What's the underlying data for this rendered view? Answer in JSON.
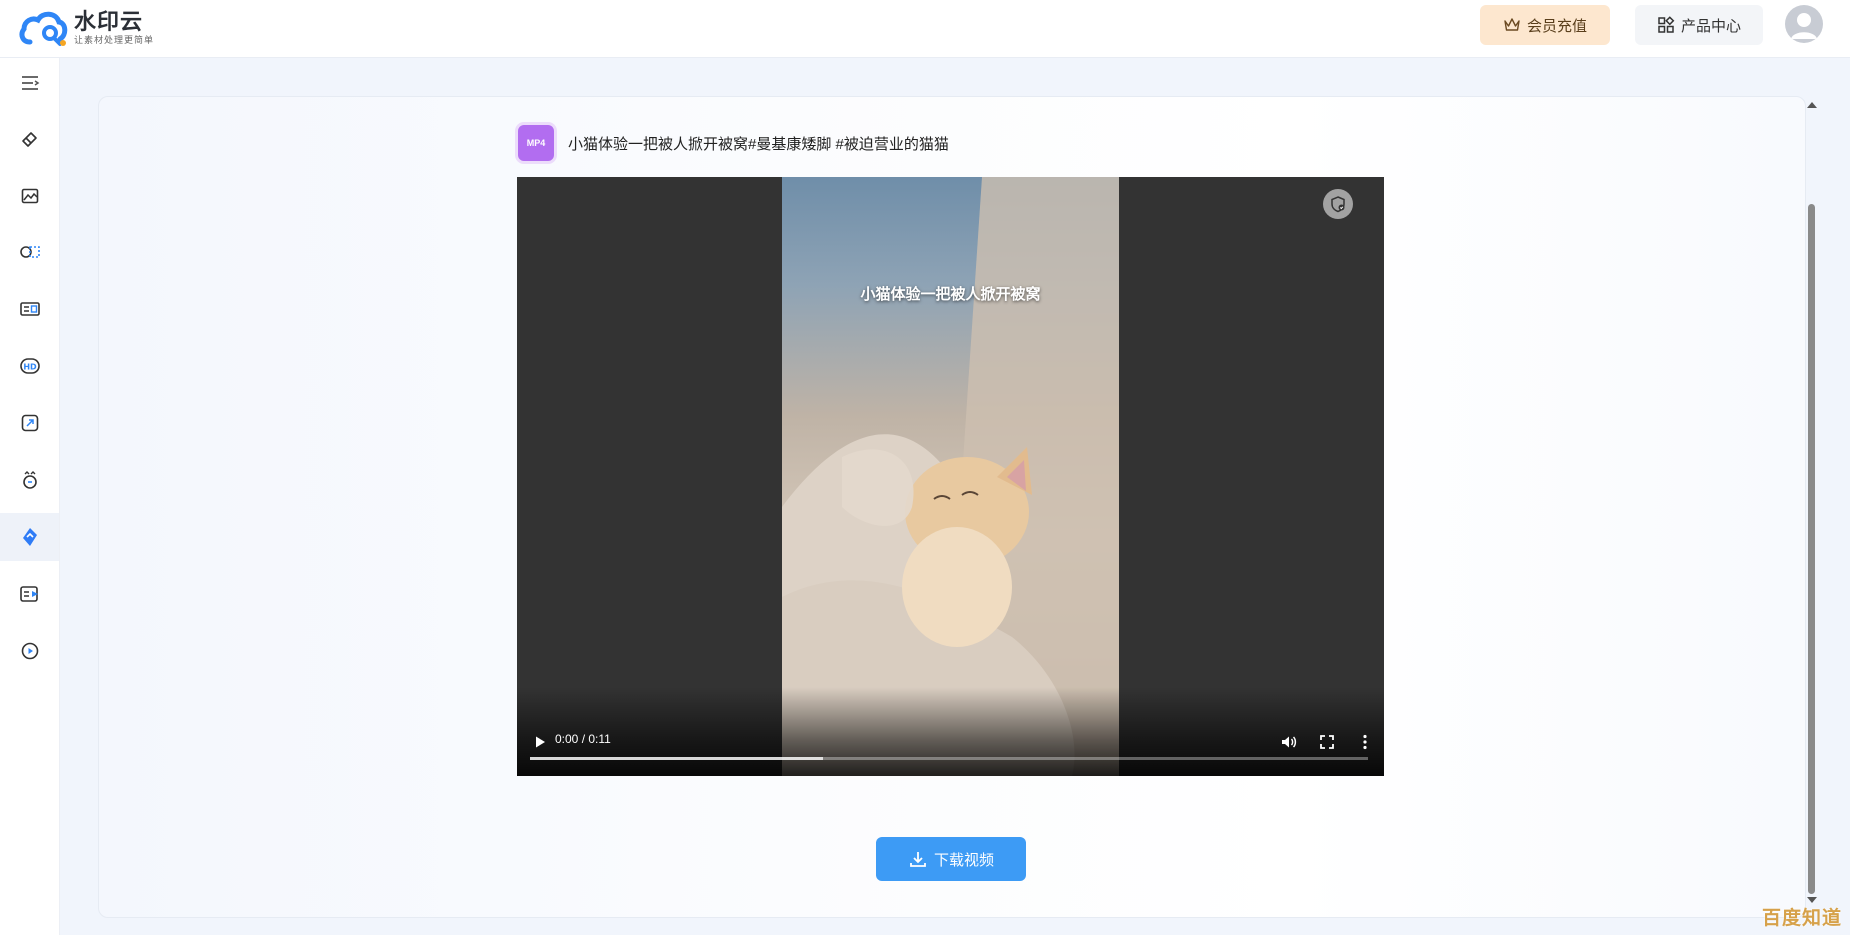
{
  "app": {
    "name": "水印云",
    "slogan": "让素材处理更简单"
  },
  "header": {
    "vip_label": "会员充值",
    "product_center_label": "产品中心"
  },
  "sidebar": {
    "items": [
      {
        "icon": "menu-collapse-icon"
      },
      {
        "icon": "eraser-icon"
      },
      {
        "icon": "image-edit-icon"
      },
      {
        "icon": "cutout-icon"
      },
      {
        "icon": "id-photo-icon"
      },
      {
        "icon": "hd-icon"
      },
      {
        "icon": "resize-icon"
      },
      {
        "icon": "ai-tools-icon"
      },
      {
        "icon": "video-watermark-icon",
        "active": true
      },
      {
        "icon": "video-list-icon"
      },
      {
        "icon": "play-circle-icon"
      }
    ]
  },
  "file": {
    "badge": "MP4",
    "title": "小猫体验一把被人掀开被窝#曼基康矮脚 #被迫营业的猫猫"
  },
  "video": {
    "caption": "小猫体验一把被人掀开被窝",
    "time": "0:00 / 0:11",
    "buffered_fraction": 0.35
  },
  "download": {
    "label": "下载视频"
  },
  "watermark": {
    "text": "百度知道"
  },
  "colors": {
    "accent": "#3d9bf5",
    "vip_bg": "#fde7cf",
    "badge": "#b26df0",
    "active_icon": "#2f7cf6"
  }
}
